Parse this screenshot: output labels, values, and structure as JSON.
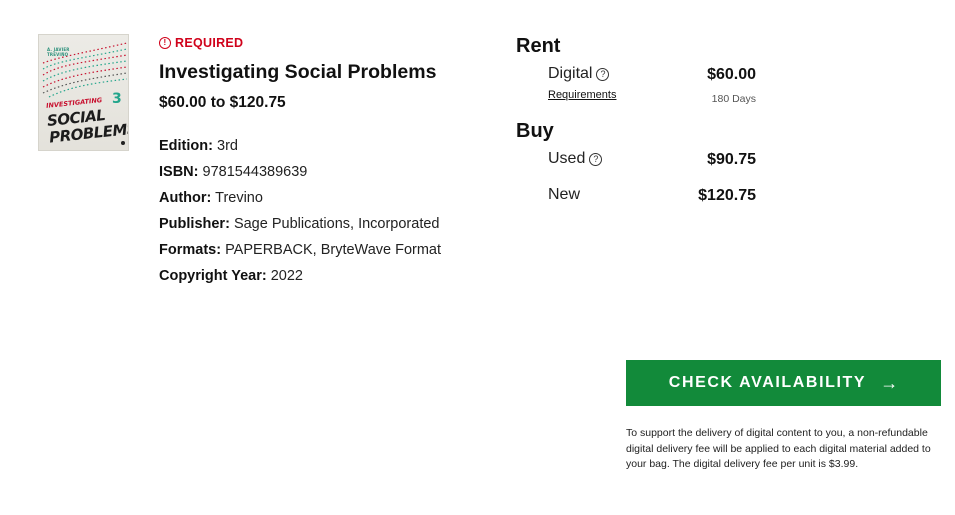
{
  "product": {
    "cover": {
      "author": "A. JAVIER\nTREVIÑO",
      "title_line1": "INVESTIGATING",
      "title_line2": "SOCIAL",
      "title_line3": "PROBLEMS",
      "edition_number": "3",
      "colors": {
        "accent": "#c8102e",
        "teal": "#22a58b"
      }
    },
    "required_label": "REQUIRED",
    "required_icon": "alert-circle-icon",
    "title": "Investigating Social Problems",
    "price_range": "$60.00 to $120.75",
    "details": [
      {
        "label": "Edition:",
        "value": "3rd"
      },
      {
        "label": "ISBN:",
        "value": "9781544389639"
      },
      {
        "label": "Author:",
        "value": "Trevino"
      },
      {
        "label": "Publisher:",
        "value": "Sage Publications, Incorporated"
      },
      {
        "label": "Formats:",
        "value": "PAPERBACK, BryteWave Format"
      },
      {
        "label": "Copyright Year:",
        "value": "2022"
      }
    ]
  },
  "rent": {
    "heading": "Rent",
    "digital": {
      "label": "Digital",
      "price": "$60.00",
      "requirements_link": "Requirements",
      "duration": "180 Days"
    }
  },
  "buy": {
    "heading": "Buy",
    "used": {
      "label": "Used",
      "price": "$90.75"
    },
    "new": {
      "label": "New",
      "price": "$120.75"
    }
  },
  "cta": {
    "label": "CHECK AVAILABILITY",
    "arrow": "→",
    "color": "#128a3a"
  },
  "note": "To support the delivery of digital content to you, a non-refundable digital delivery fee will be applied to each digital material added to your bag. The digital delivery fee per unit is $3.99."
}
